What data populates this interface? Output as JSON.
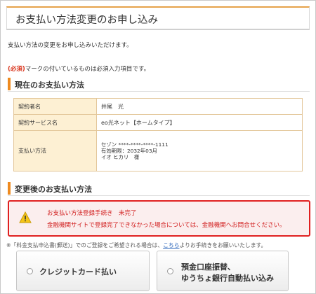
{
  "page": {
    "title": "お支払い方法変更のお申し込み",
    "intro": "支払い方法の変更をお申し込みいただけます。",
    "required_mark": "(必須)",
    "required_note": "マークの付いているものは必須入力項目です。"
  },
  "current_section": {
    "title": "現在のお支払い方法",
    "rows": [
      {
        "label": "契約者名",
        "value": "井尾　光"
      },
      {
        "label": "契約サービス名",
        "value": "eo光ネット【ホームタイプ】"
      }
    ],
    "payment": {
      "label": "支払い方法",
      "line1": "セゾン ****-****-****-1111",
      "line2": "有効期限：2032年03月",
      "line3": "イオ ヒカリ　様"
    }
  },
  "new_section": {
    "title": "変更後のお支払い方法"
  },
  "alert": {
    "line1": "お支払い方法登録手続き　未完了",
    "line2": "金融機関サイトで登録完了できなかった場合については、金融機関へお問合せください。",
    "icon": "warning-icon",
    "color": "#e02020"
  },
  "footnote": {
    "prefix": "※「料金支払申込書(郵送)」でのご登録をご希望される場合は、",
    "link": "こちら",
    "suffix": "よりお手続きをお願いいたします。"
  },
  "options": {
    "credit": "クレジットカード払い",
    "bank_line1": "預金口座振替、",
    "bank_line2": "ゆうちょ銀行自動払い込み"
  },
  "colors": {
    "accent": "#ee8a1f",
    "table_header_bg": "#fdf0d3",
    "alert_red": "#e02020"
  }
}
